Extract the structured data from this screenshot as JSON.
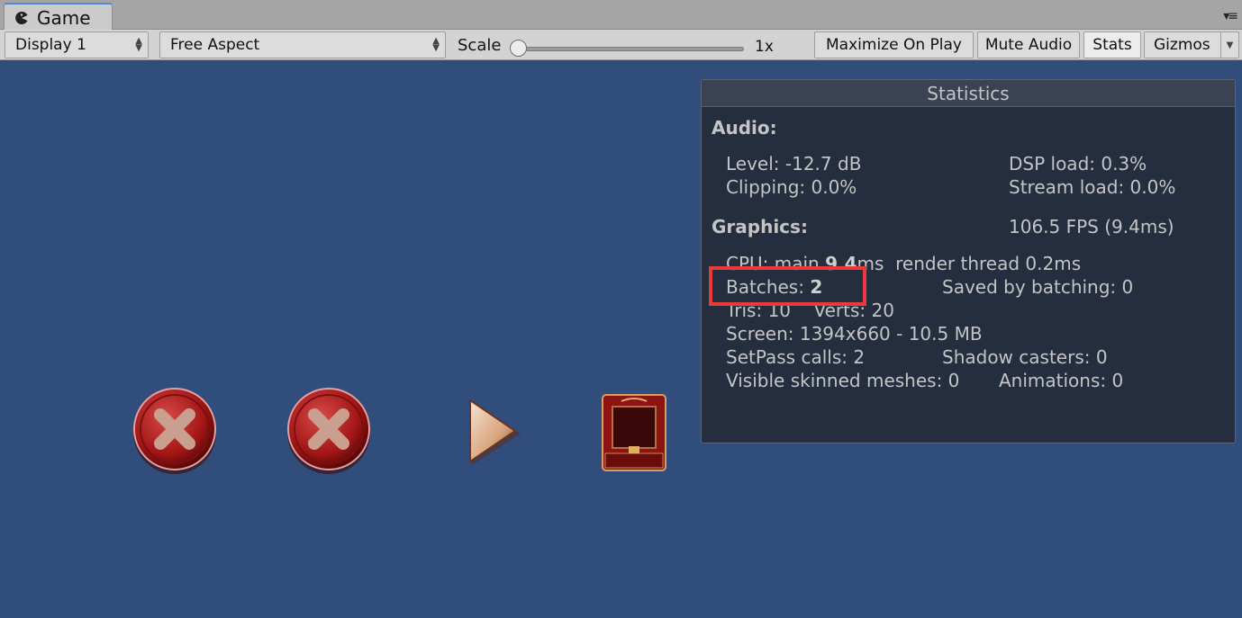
{
  "window": {
    "tab_label": "Game",
    "tab_icon": "pacman-game-icon"
  },
  "toolbar": {
    "display": "Display 1",
    "aspect": "Free Aspect",
    "scale_label": "Scale",
    "scale_value": "1x",
    "maximize": "Maximize On Play",
    "mute": "Mute Audio",
    "stats": "Stats",
    "gizmos": "Gizmos"
  },
  "stats": {
    "title": "Statistics",
    "audio_heading": "Audio:",
    "level": "Level: -12.7 dB",
    "dsp": "DSP load: 0.3%",
    "clipping": "Clipping: 0.0%",
    "stream": "Stream load: 0.0%",
    "graphics_heading": "Graphics:",
    "fps": "106.5 FPS (9.4ms)",
    "cpu_prefix": "CPU: main ",
    "cpu_main": "9.4",
    "cpu_suffix": "ms  render thread 0.2ms",
    "batches_label": "Batches: ",
    "batches_value": "2",
    "saved": "Saved by batching: 0",
    "tris": "Tris: 10    Verts: 20",
    "screen": "Screen: 1394x660 - 10.5 MB",
    "setpass": "SetPass calls: 2",
    "shadow": "Shadow casters: 0",
    "skinned": "Visible skinned meshes: 0",
    "animations": "Animations: 0"
  },
  "colors": {
    "game_background": "#314d7b",
    "highlight": "#ea3a3a"
  }
}
